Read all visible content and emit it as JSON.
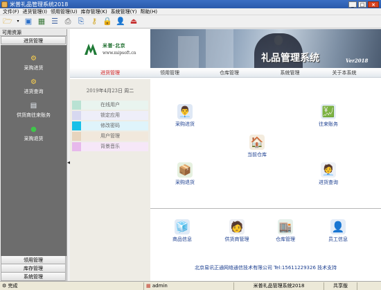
{
  "window": {
    "title": "米普礼品管理系统2018",
    "icons": [
      "app-icon"
    ],
    "controls": [
      "minimize",
      "maximize",
      "close"
    ]
  },
  "menu": [
    "文件(F)",
    "进货管理(I)",
    "领用管理(U)",
    "库存管理(K)",
    "系统管理(Y)",
    "帮助(H)"
  ],
  "toolbar": {
    "icons": [
      "open-folder-icon",
      "dropdown-arrow-icon",
      "window-icon",
      "grid-icon",
      "list-icon",
      "print-icon",
      "print-preview-icon",
      "key-icon",
      "lock-icon",
      "user-icon",
      "exit-icon"
    ]
  },
  "left_panel": {
    "title": "可用资源",
    "active_section": "进货管理",
    "items": [
      {
        "label": "采购进货",
        "icon": "purchase-icon"
      },
      {
        "label": "进货查询",
        "icon": "query-icon"
      },
      {
        "label": "供货商往来账务",
        "icon": "supplier-account-icon"
      },
      {
        "label": "采购退货",
        "icon": "return-icon"
      }
    ],
    "bottom_sections": [
      "领用管理",
      "库存管理",
      "系统管理"
    ]
  },
  "banner": {
    "company": "米普·北京",
    "url": "www.mipsoft.cn",
    "title": "礼品管理系统",
    "version": "Ver2018"
  },
  "tabs": [
    "进货管理",
    "领用管理",
    "仓库管理",
    "系统管理",
    "关于本系统"
  ],
  "date": "2019年4月23日 周二",
  "quick_items": [
    {
      "label": "在线用户",
      "color": "#b9e2d3"
    },
    {
      "label": "锁定应用",
      "color": "#d7d8f0"
    },
    {
      "label": "修改密码",
      "color": "#17c0e8"
    },
    {
      "label": "用户管理",
      "color": "#e7d4bd"
    },
    {
      "label": "背景音乐",
      "color": "#e7b9ec"
    }
  ],
  "modules": [
    {
      "label": "采购进货",
      "icon": "purchase-module-icon"
    },
    {
      "label": "往来账务",
      "icon": "account-module-icon"
    },
    {
      "label": "当前仓库",
      "icon": "warehouse-module-icon"
    },
    {
      "label": "采购退货",
      "icon": "return-module-icon"
    },
    {
      "label": "进货查询",
      "icon": "query-module-icon"
    }
  ],
  "bottom_modules": [
    {
      "label": "商品信息",
      "icon": "goods-info-icon"
    },
    {
      "label": "供货商管理",
      "icon": "supplier-icon"
    },
    {
      "label": "仓库管理",
      "icon": "warehouse-manage-icon"
    },
    {
      "label": "员工信息",
      "icon": "staff-icon"
    }
  ],
  "footer": "北京易讯正通网络通信技术有限公司 Tel:15611229326 技术支持",
  "status": {
    "state": "完成",
    "user": "admin",
    "app": "米普礼品管理系统2018",
    "edition": "共享版"
  },
  "colors": {
    "title_bar": "#2a5aab",
    "active_tab": "#d01818",
    "link": "#1a3d8f",
    "nav_bg": "#6d6d6d"
  }
}
